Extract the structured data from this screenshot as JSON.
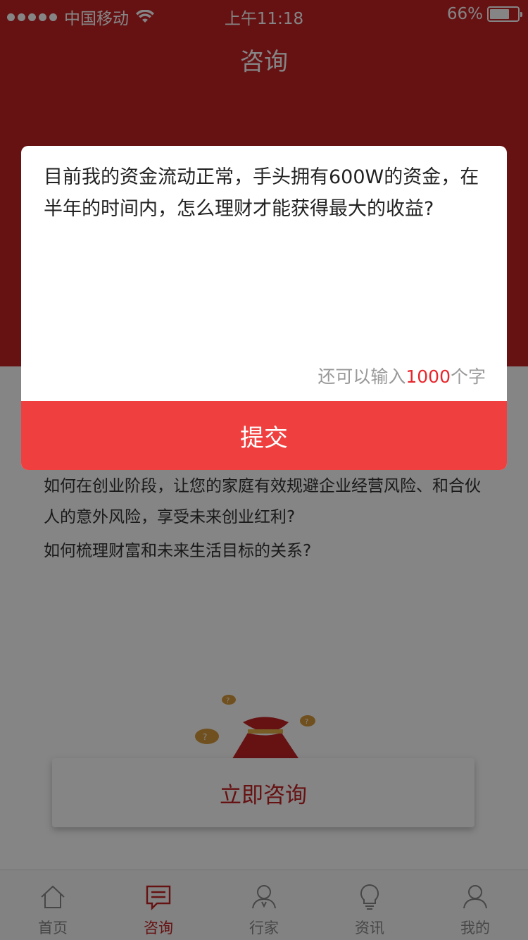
{
  "status_bar": {
    "carrier": "中国移动",
    "time": "上午11:18",
    "battery": "66%",
    "battery_level": 0.66
  },
  "header": {
    "title": "咨询"
  },
  "questions": [
    "如何在创业阶段，让您的家庭有效规避企业经营风险、和合伙人的意外风险，享受未来创业红利?",
    "如何梳理财富和未来生活目标的关系?"
  ],
  "consult_button": {
    "label": "立即咨询"
  },
  "dialog": {
    "text": "目前我的资金流动正常，手头拥有600W的资金，在半年的时间内，怎么理财才能获得最大的收益?",
    "counter_prefix": "还可以输入",
    "counter_value": "1000",
    "counter_suffix": "个字",
    "submit_label": "提交"
  },
  "tabbar": {
    "items": [
      {
        "label": "首页",
        "icon": "home-icon"
      },
      {
        "label": "咨询",
        "icon": "chat-icon"
      },
      {
        "label": "行家",
        "icon": "expert-icon"
      },
      {
        "label": "资讯",
        "icon": "bulb-icon"
      },
      {
        "label": "我的",
        "icon": "user-icon"
      }
    ],
    "active_index": 1
  },
  "colors": {
    "brand_red": "#c42326",
    "submit_red": "#ef3f3f",
    "counter_red": "#e8262c"
  }
}
